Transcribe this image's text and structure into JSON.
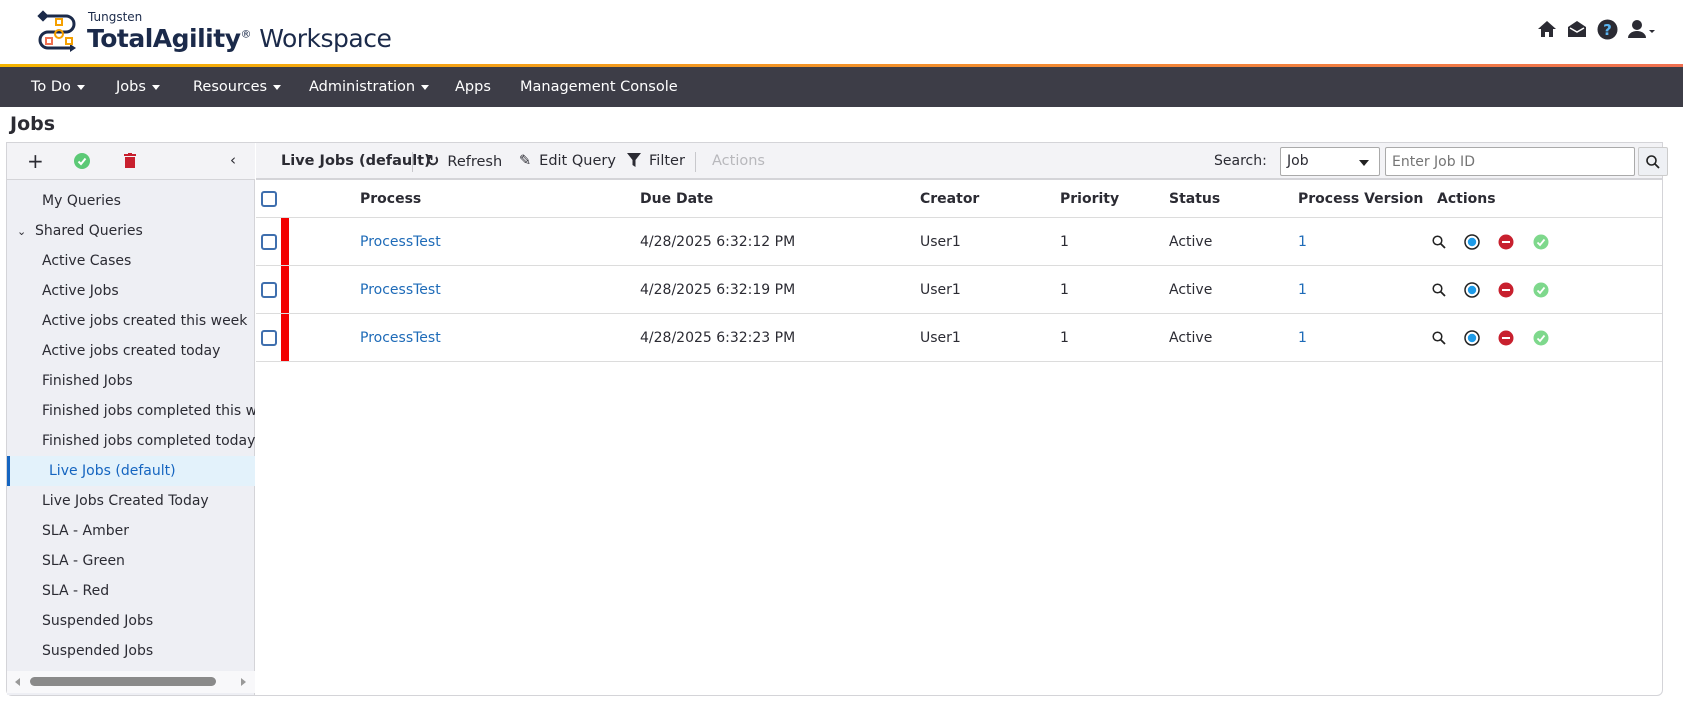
{
  "header": {
    "brand_small": "Tungsten",
    "brand_main": "TotalAgility",
    "brand_reg": "®",
    "brand_suffix": "Workspace",
    "icons": [
      "home-icon",
      "envelope-open-icon",
      "help-icon",
      "user-icon"
    ]
  },
  "nav": {
    "items": [
      {
        "label": "To Do",
        "dropdown": true
      },
      {
        "label": "Jobs",
        "dropdown": true
      },
      {
        "label": "Resources",
        "dropdown": true
      },
      {
        "label": "Administration",
        "dropdown": true
      },
      {
        "label": "Apps",
        "dropdown": false
      },
      {
        "label": "Management Console",
        "dropdown": false
      }
    ]
  },
  "page": {
    "title": "Jobs"
  },
  "sidebar": {
    "tools": [
      "add-icon",
      "check-circle-icon",
      "trash-icon",
      "collapse-icon"
    ],
    "items": [
      {
        "label": "My Queries"
      },
      {
        "label": "Shared Queries",
        "group": true
      },
      {
        "label": "Active Cases"
      },
      {
        "label": "Active Jobs"
      },
      {
        "label": "Active jobs created this week"
      },
      {
        "label": "Active jobs created today"
      },
      {
        "label": "Finished Jobs"
      },
      {
        "label": "Finished jobs completed this week"
      },
      {
        "label": "Finished jobs completed today"
      },
      {
        "label": "Live Jobs (default)",
        "active": true
      },
      {
        "label": "Live Jobs Created Today"
      },
      {
        "label": "SLA - Amber"
      },
      {
        "label": "SLA - Green"
      },
      {
        "label": "SLA - Red"
      },
      {
        "label": "Suspended Jobs"
      },
      {
        "label": "Suspended Jobs"
      }
    ]
  },
  "toolbar": {
    "query_name": "Live Jobs (default)",
    "refresh": "Refresh",
    "edit_query": "Edit Query",
    "filter": "Filter",
    "actions": "Actions",
    "search_label": "Search:",
    "search_type": "Job",
    "search_placeholder": "Enter Job ID"
  },
  "table": {
    "columns": [
      "Process",
      "Due Date",
      "Creator",
      "Priority",
      "Status",
      "Process Version",
      "Actions"
    ],
    "rows": [
      {
        "process": "ProcessTest",
        "due": "4/28/2025 6:32:12 PM",
        "creator": "User1",
        "priority": "1",
        "status": "Active",
        "version": "1"
      },
      {
        "process": "ProcessTest",
        "due": "4/28/2025 6:32:19 PM",
        "creator": "User1",
        "priority": "1",
        "status": "Active",
        "version": "1"
      },
      {
        "process": "ProcessTest",
        "due": "4/28/2025 6:32:23 PM",
        "creator": "User1",
        "priority": "1",
        "status": "Active",
        "version": "1"
      }
    ],
    "row_actions": [
      "view-icon",
      "progress-icon",
      "terminate-icon",
      "complete-icon"
    ]
  },
  "colors": {
    "nav_bg": "#3d3d47",
    "link": "#1e6bb8",
    "overdue": "#f20000",
    "accent": "#f5b400"
  }
}
